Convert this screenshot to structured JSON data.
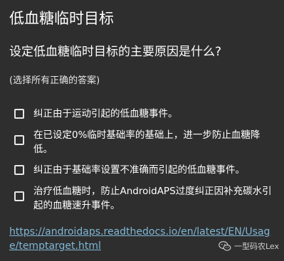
{
  "dialog": {
    "title": "低血糖临时目标",
    "question": "设定低血糖临时目标的主要原因是什么?",
    "hint": "(选择所有正确的答案)"
  },
  "options": [
    {
      "label": "纠正由于运动引起的低血糖事件。",
      "checked": false
    },
    {
      "label": "在已设定0%临时基础率的基础上，进一步防止血糖降低。",
      "checked": false
    },
    {
      "label": "纠正由于基础率设置不准确而引起的低血糖事件。",
      "checked": false
    },
    {
      "label": "治疗低血糖时，防止AndroidAPS过度纠正因补充碳水引起的血糖速升事件。",
      "checked": false
    }
  ],
  "link": {
    "text": "https://androidaps.readthedocs.io/en/latest/EN/Usage/temptarget.html"
  },
  "watermark": {
    "icon": "wechat-icon",
    "text": "一型码农Lex"
  },
  "colors": {
    "background": "#2e2e2e",
    "text": "#ffffff",
    "link": "#7fb7d6"
  }
}
